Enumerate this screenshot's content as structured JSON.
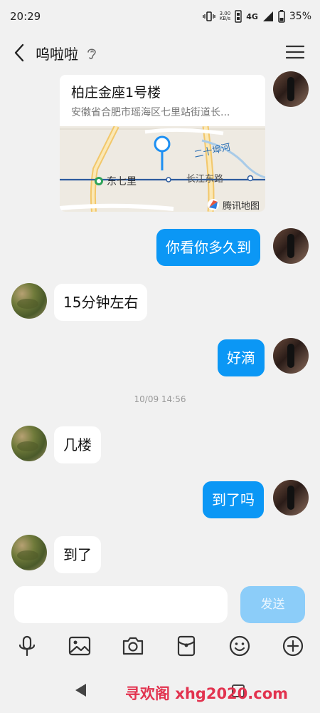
{
  "status": {
    "time": "20:29",
    "speed_value": "3.00",
    "speed_unit": "KB/s",
    "network": "4G",
    "battery": "35%"
  },
  "header": {
    "title": "呜啦啦"
  },
  "location_card": {
    "title": "柏庄金座1号楼",
    "address": "安徽省合肥市瑶海区七里站街道长...",
    "map_labels": {
      "station": "东七里",
      "road": "长江东路",
      "river": "二十埠河",
      "brand": "腾讯地图"
    }
  },
  "messages": [
    {
      "from": "self",
      "text": "你看你多久到"
    },
    {
      "from": "other",
      "text": "15分钟左右"
    },
    {
      "from": "self",
      "text": "好滴"
    },
    {
      "from": "other",
      "text": "几楼"
    },
    {
      "from": "self",
      "text": "到了吗"
    },
    {
      "from": "other",
      "text": "到了"
    }
  ],
  "timestamp": "10/09 14:56",
  "input": {
    "value": "",
    "placeholder": ""
  },
  "send_label": "发送",
  "toolbar_icons": [
    "microphone-icon",
    "image-icon",
    "camera-icon",
    "red-packet-icon",
    "emoji-icon",
    "plus-icon"
  ],
  "watermark": "寻欢阁 xhg2020.com",
  "colors": {
    "outgoing_bubble": "#0b97f5",
    "incoming_bubble": "#ffffff",
    "background": "#f1f1f1",
    "send_button": "#8ccdf9",
    "watermark": "#e2334f"
  }
}
